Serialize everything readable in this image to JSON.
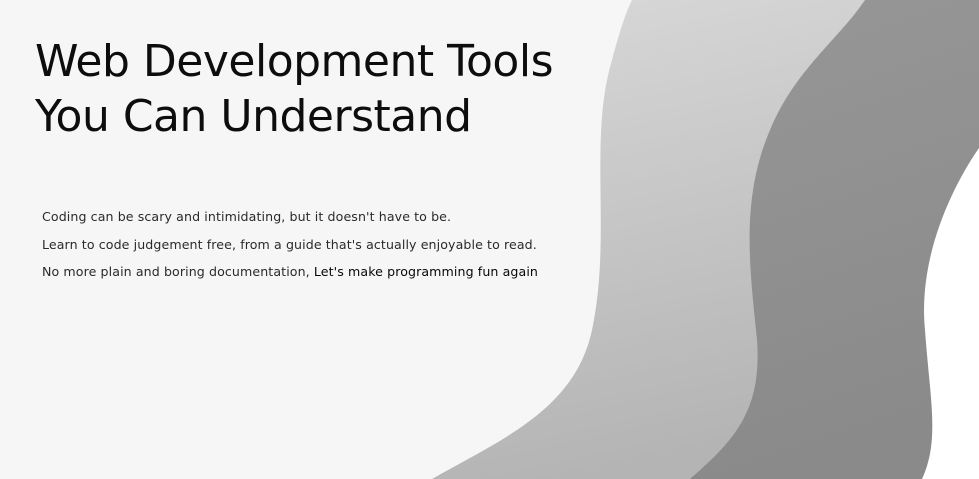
{
  "hero": {
    "title_line_1": "Web Development Tools",
    "title_line_2": "You Can Understand",
    "body_line_1": "Coding can be scary and intimidating, but it doesn't have to be.",
    "body_line_2": "Learn to code judgement free, from a guide that's actually enjoyable to read.",
    "body_line_3_prefix": "No more plain and boring documentation,",
    "body_line_3_cta": "Let's make programming fun again"
  },
  "colors": {
    "background": "#f6f6f6",
    "wave_light": "#c2c2c2",
    "wave_dark": "#8f8f8f",
    "wave_white": "#ffffff",
    "text": "#0d0d0d"
  }
}
